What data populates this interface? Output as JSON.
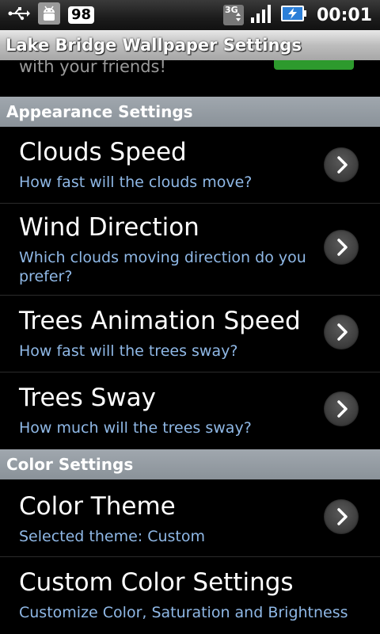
{
  "status_bar": {
    "icons": [
      "usb-icon",
      "android-debug-icon",
      "3g-icon",
      "signal-icon",
      "battery-charging-icon"
    ],
    "notification_count": "98",
    "network_label": "3G",
    "time": "00:01"
  },
  "header": {
    "title": "Lake Bridge Wallpaper Settings"
  },
  "partial_item": {
    "summary": "with your friends!"
  },
  "sections": [
    {
      "title": "Appearance Settings",
      "items": [
        {
          "title": "Clouds Speed",
          "summary": "How fast will the clouds move?",
          "icon": "chevron-right-icon"
        },
        {
          "title": "Wind Direction",
          "summary": "Which clouds moving direction do you prefer?",
          "icon": "chevron-right-icon"
        },
        {
          "title": "Trees Animation Speed",
          "summary": "How fast will the trees sway?",
          "icon": "chevron-right-icon"
        },
        {
          "title": "Trees Sway",
          "summary": "How much will the trees sway?",
          "icon": "chevron-right-icon"
        }
      ]
    },
    {
      "title": "Color Settings",
      "items": [
        {
          "title": "Color Theme",
          "summary": "Selected theme: Custom",
          "icon": "chevron-right-icon"
        },
        {
          "title": "Custom Color Settings",
          "summary": "Customize Color, Saturation and Brightness"
        }
      ]
    }
  ],
  "colors": {
    "summary_text": "#8fb8e6",
    "section_header": "#8a9299",
    "battery_accent": "#2c7fd8",
    "partial_button": "#2d9a2d"
  }
}
